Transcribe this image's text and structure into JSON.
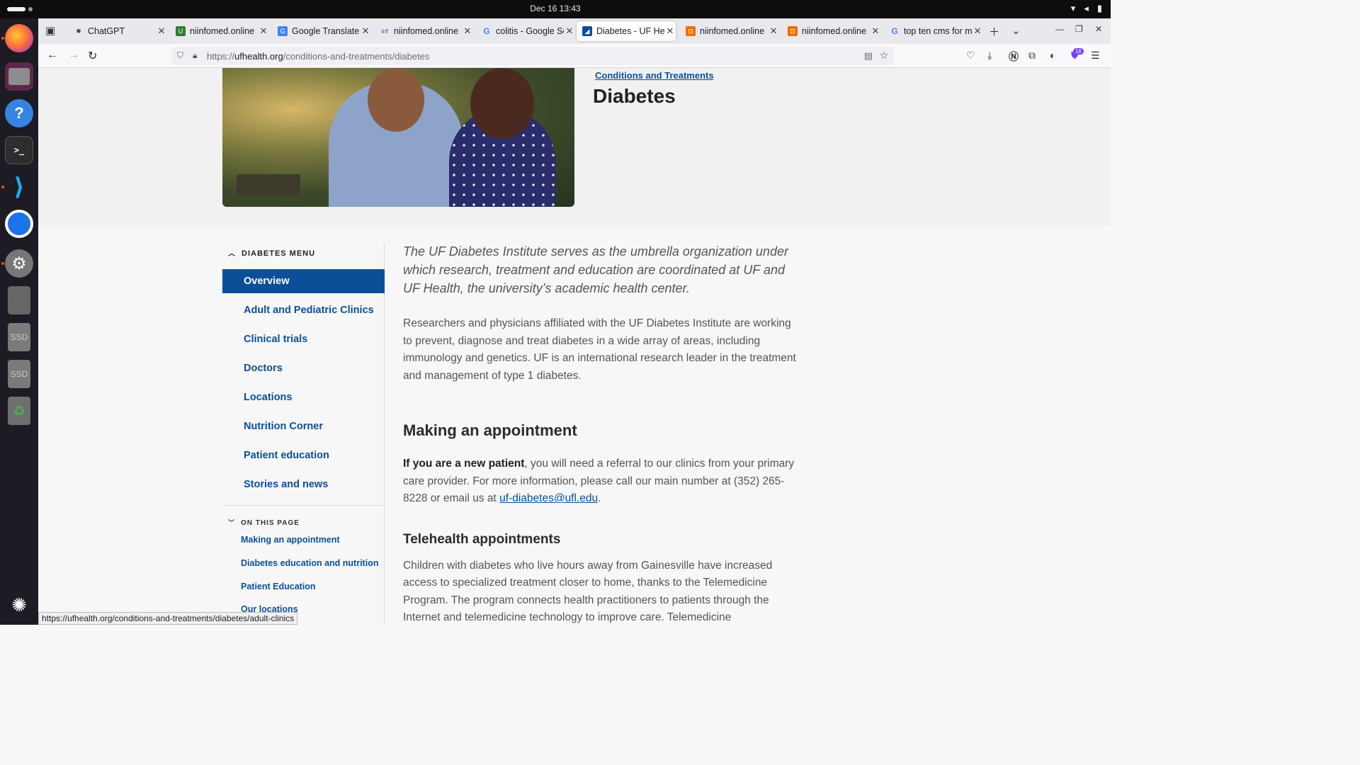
{
  "system": {
    "clock": "Dec 16  13:43"
  },
  "tabs": [
    {
      "label": "ChatGPT",
      "favicon_color": "#ffffff"
    },
    {
      "label": "niinfomed.online",
      "favicon_color": "#2e7d32"
    },
    {
      "label": "Google Translate",
      "favicon_color": "#4285f4"
    },
    {
      "label": "niinfomed.online",
      "favicon_color": "#1565c0"
    },
    {
      "label": "colitis - Google Se",
      "favicon_color": "#ffffff"
    },
    {
      "label": "Diabetes - UF Hea",
      "favicon_color": "#0b4f99"
    },
    {
      "label": "niinfomed.online",
      "favicon_color": "#ef6c00"
    },
    {
      "label": "niinfomed.online",
      "favicon_color": "#ef6c00"
    },
    {
      "label": "top ten cms for m",
      "favicon_color": "#ffffff"
    }
  ],
  "nav": {
    "url_prefix": "https://",
    "url_host": "ufhealth.org",
    "url_path": "/conditions-and-treatments/diabetes",
    "extension_badge": "16"
  },
  "page": {
    "breadcrumb": "Conditions and Treatments",
    "title": "Diabetes",
    "sidebar": {
      "menu_title": "DIABETES MENU",
      "items": [
        "Overview",
        "Adult and Pediatric Clinics",
        "Clinical trials",
        "Doctors",
        "Locations",
        "Nutrition Corner",
        "Patient education",
        "Stories and news"
      ],
      "on_this_page_title": "ON THIS PAGE",
      "on_this_page": [
        "Making an appointment",
        "Diabetes education and nutrition",
        "Patient Education",
        "Our locations"
      ]
    },
    "lead": "The UF Diabetes Institute serves as the umbrella organization under which research, treatment and education are coordinated at UF and UF Health, the university’s academic health center.",
    "intro": "Researchers and physicians affiliated with the UF Diabetes Institute are working to prevent, diagnose and treat diabetes in a wide array of areas, including immunology and genetics. UF is an international research leader in the treatment and management of type 1 diabetes.",
    "appointment_heading": "Making an appointment",
    "appointment_bold": "If you are a new patient",
    "appointment_text": ", you will need a referral to our clinics from your primary care provider. For more information, please call our main number at (352) 265-8228 or email us at ",
    "appointment_email": "uf-diabetes@ufl.edu",
    "appointment_end": ".",
    "telehealth_heading": "Telehealth appointments",
    "telehealth_text": "Children with diabetes who live hours away from Gainesville have increased access to specialized treatment closer to home, thanks to the Telemedicine Program. The program connects health practitioners to patients through the Internet and telemedicine technology to improve care. Telemedicine"
  },
  "status_url": "https://ufhealth.org/conditions-and-treatments/diabetes/adult-clinics"
}
